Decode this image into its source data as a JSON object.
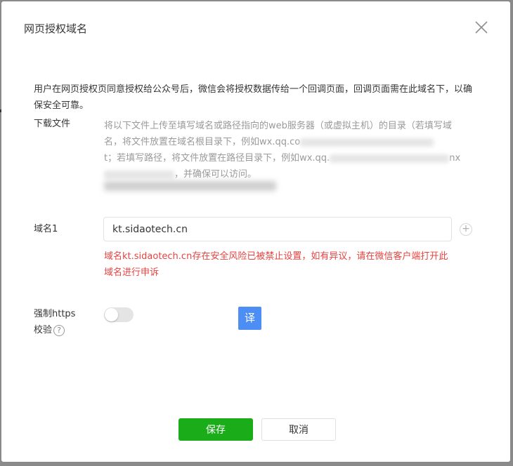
{
  "dialog": {
    "title": "网页授权域名",
    "intro": "用户在网页授权页同意授权给公众号后，微信会将授权数据传给一个回调页面，回调页面需在此域名下，以确保安全可靠。"
  },
  "download": {
    "label": "下载文件",
    "line1": "将以下文件上传至填写域名或路径指向的web服务器（或虚拟主机）的目录（若填写域",
    "line2_prefix": "名，将文件放置在域名根目录下，例如wx.qq.co",
    "line3_prefix": "t；若填写路径，将文件放置在路径目录下，例如wx.qq.",
    "line3_suffix": "nx",
    "line4_suffix": "，并确保可以访问。"
  },
  "domain": {
    "label": "域名1",
    "value": "kt.sidaotech.cn",
    "add_symbol": "+",
    "error": "域名kt.sidaotech.cn存在安全风险已被禁止设置，如有异议，请在微信客户端打开此域名进行申诉"
  },
  "https": {
    "label_line1": "强制https",
    "label_line2": "校验",
    "help_symbol": "?",
    "enabled": false
  },
  "translate": {
    "label": "译"
  },
  "footer": {
    "save_label": "保存",
    "cancel_label": "取消"
  },
  "colors": {
    "primary": "#1aad19",
    "error": "#e64340",
    "translate": "#4c8ef4"
  }
}
